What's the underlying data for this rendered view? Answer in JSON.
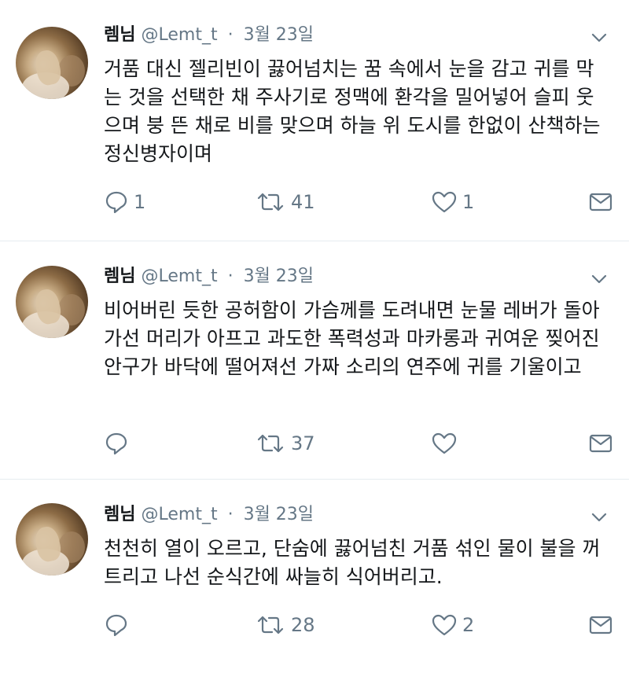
{
  "tweets": [
    {
      "author_name": "렘님",
      "author_handle": "@Lemt_t",
      "separator": "·",
      "date": "3월 23일",
      "text": "거품 대신 젤리빈이 끓어넘치는 꿈 속에서 눈을 감고 귀를 막는 것을 선택한 채 주사기로 정맥에 환각을 밀어넣어 슬피 웃으며 붕 뜬 채로 비를 맞으며 하늘 위 도시를 한없이 산책하는 정신병자이며",
      "reply_count": "1",
      "retweet_count": "41",
      "like_count": "1"
    },
    {
      "author_name": "렘님",
      "author_handle": "@Lemt_t",
      "separator": "·",
      "date": "3월 23일",
      "text": "비어버린 듯한 공허함이 가슴께를 도려내면 눈물 레버가 돌아가선 머리가 아프고 과도한 폭력성과 마카롱과 귀여운 찢어진 안구가 바닥에 떨어져선 가짜 소리의 연주에 귀를 기울이고",
      "reply_count": "",
      "retweet_count": "37",
      "like_count": ""
    },
    {
      "author_name": "렘님",
      "author_handle": "@Lemt_t",
      "separator": "·",
      "date": "3월 23일",
      "text": "천천히 열이 오르고, 단숨에 끓어넘친 거품 섞인 물이 불을 꺼트리고 나선 순식간에 싸늘히 식어버리고.",
      "reply_count": "",
      "retweet_count": "28",
      "like_count": "2"
    }
  ],
  "icons": {
    "reply": "reply-icon",
    "retweet": "retweet-icon",
    "like": "heart-icon",
    "dm": "envelope-icon",
    "caret": "chevron-down-icon"
  },
  "colors": {
    "text": "#14171a",
    "secondary": "#657786",
    "divider": "#e6ecf0"
  }
}
